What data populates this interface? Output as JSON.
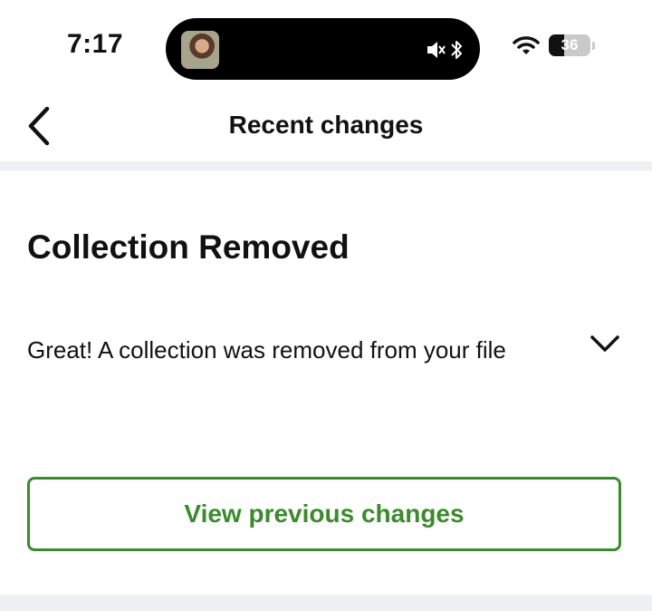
{
  "status_bar": {
    "time": "7:17",
    "battery_level": "36",
    "icons": [
      "muted-speaker-icon",
      "bluetooth-icon",
      "wifi-icon",
      "battery-icon"
    ]
  },
  "nav": {
    "title": "Recent changes",
    "back_icon": "chevron-left-icon"
  },
  "change": {
    "title": "Collection Removed",
    "description": "Great! A collection was removed from your file",
    "expand_icon": "chevron-down-icon"
  },
  "actions": {
    "view_previous_label": "View previous changes"
  },
  "colors": {
    "accent_green": "#3c8a2e",
    "divider_gray": "#eef0f3",
    "text": "#111111"
  }
}
